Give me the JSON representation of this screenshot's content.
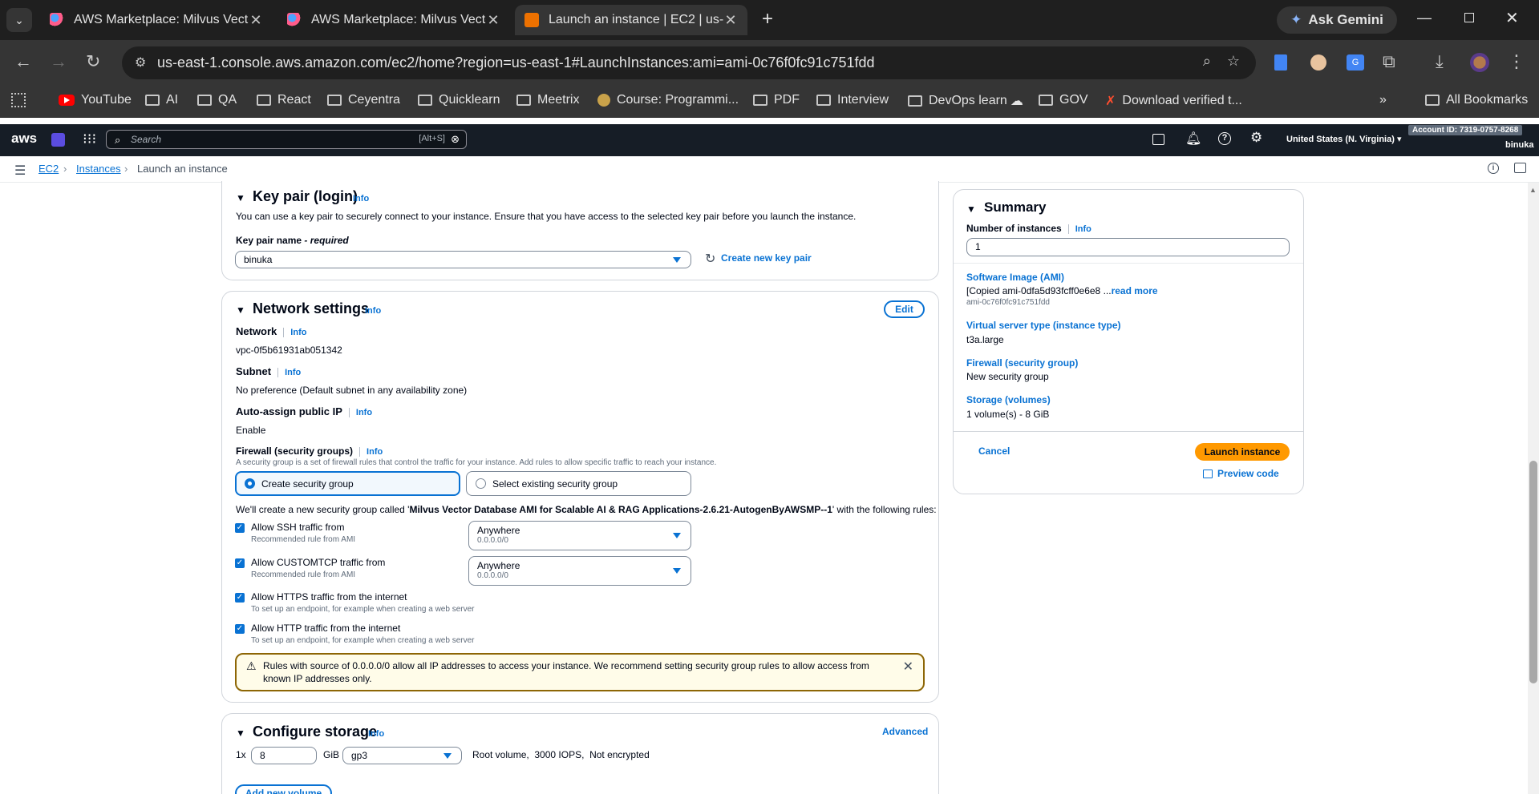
{
  "browser": {
    "tabs": [
      {
        "title": "AWS Marketplace: Milvus Vector",
        "active": false
      },
      {
        "title": "AWS Marketplace: Milvus Vector",
        "active": false
      },
      {
        "title": "Launch an instance | EC2 | us-ea",
        "active": true
      }
    ],
    "ask_gemini": "Ask Gemini",
    "url": "us-east-1.console.aws.amazon.com/ec2/home?region=us-east-1#LaunchInstances:ami=ami-0c76f0fc91c751fdd",
    "bookmarks": [
      "YouTube",
      "AI",
      "QA",
      "React",
      "Ceyentra",
      "Quicklearn",
      "Meetrix",
      "Course: Programmi...",
      "PDF",
      "Interview",
      "DevOps learn",
      "GOV",
      "Download verified t..."
    ],
    "all_bookmarks": "All Bookmarks"
  },
  "aws_header": {
    "logo": "aws",
    "search_placeholder": "Search",
    "search_shortcut": "[Alt+S]",
    "region": "United States (N. Virginia)",
    "account_id": "Account ID: 7319-0757-8268",
    "user": "binuka"
  },
  "breadcrumb": [
    "EC2",
    "Instances",
    "Launch an instance"
  ],
  "key_pair": {
    "title": "Key pair (login)",
    "info": "Info",
    "description": "You can use a key pair to securely connect to your instance. Ensure that you have access to the selected key pair before you launch the instance.",
    "name_label": "Key pair name",
    "required": "- required",
    "value": "binuka",
    "create_new": "Create new key pair"
  },
  "network": {
    "title": "Network settings",
    "info": "Info",
    "edit": "Edit",
    "network_label": "Network",
    "network_value": "vpc-0f5b61931ab051342",
    "subnet_label": "Subnet",
    "subnet_value": "No preference (Default subnet in any availability zone)",
    "public_ip_label": "Auto-assign public IP",
    "public_ip_value": "Enable",
    "firewall_label": "Firewall (security groups)",
    "firewall_desc": "A security group is a set of firewall rules that control the traffic for your instance. Add rules to allow specific traffic to reach your instance.",
    "create_sg": "Create security group",
    "select_sg": "Select existing security group",
    "sg_sentence_pre": "We'll create a new security group called '",
    "sg_name": "Milvus Vector Database AMI for Scalable AI & RAG Applications-2.6.21-AutogenByAWSMP--1",
    "sg_sentence_post": "' with the following rules:",
    "rules": [
      {
        "label": "Allow SSH traffic from",
        "sub": "Recommended rule from AMI",
        "select": "Anywhere",
        "select_sub": "0.0.0.0/0"
      },
      {
        "label": "Allow CUSTOMTCP traffic from",
        "sub": "Recommended rule from AMI",
        "select": "Anywhere",
        "select_sub": "0.0.0.0/0"
      },
      {
        "label": "Allow HTTPS traffic from the internet",
        "sub": "To set up an endpoint, for example when creating a web server"
      },
      {
        "label": "Allow HTTP traffic from the internet",
        "sub": "To set up an endpoint, for example when creating a web server"
      }
    ],
    "warning_line1": "Rules with source of 0.0.0.0/0 allow all IP addresses to access your instance. We recommend setting security group rules to allow access from",
    "warning_line2": "known IP addresses only."
  },
  "storage": {
    "title": "Configure storage",
    "info": "Info",
    "advanced": "Advanced",
    "count": "1x",
    "size": "8",
    "unit": "GiB",
    "type": "gp3",
    "details": "Root volume,  3000 IOPS,  Not encrypted",
    "add_volume": "Add new volume"
  },
  "summary": {
    "title": "Summary",
    "instances_label": "Number of instances",
    "info": "Info",
    "instances_value": "1",
    "ami_label": "Software Image (AMI)",
    "ami_value": "[Copied ami-0dfa5d93fcff0e6e8 ...",
    "read_more": "read more",
    "ami_id": "ami-0c76f0fc91c751fdd",
    "type_label": "Virtual server type (instance type)",
    "type_value": "t3a.large",
    "firewall_label": "Firewall (security group)",
    "firewall_value": "New security group",
    "storage_label": "Storage (volumes)",
    "storage_value": "1 volume(s) - 8 GiB",
    "cancel": "Cancel",
    "launch": "Launch instance",
    "preview": "Preview code"
  }
}
